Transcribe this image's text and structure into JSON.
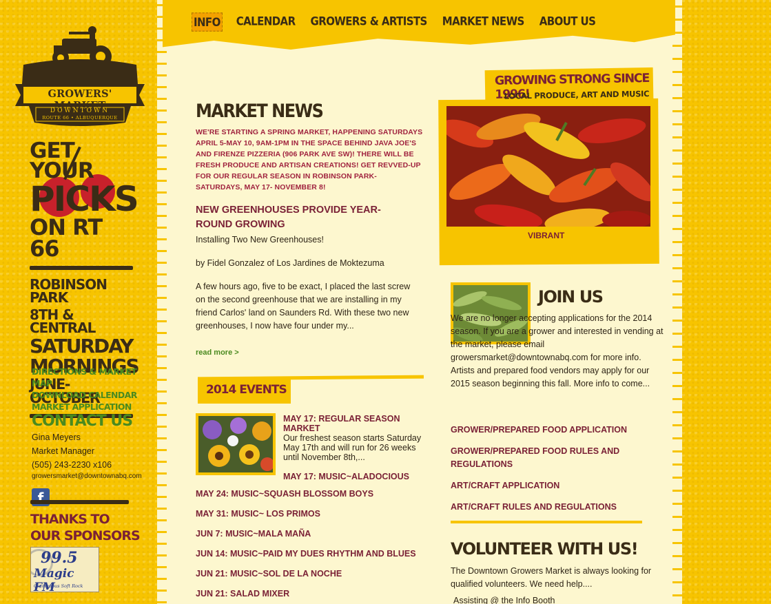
{
  "nav": {
    "items": [
      "INFO",
      "CALENDAR",
      "GROWERS & ARTISTS",
      "MARKET NEWS",
      "ABOUT US"
    ],
    "active": "INFO"
  },
  "logo": {
    "name": "GROWERS' MARKET",
    "sub1": "DOWNTOWN",
    "sub2": "ROUTE 66 • ALBUQUERQUE"
  },
  "promo": {
    "line1": "GET YOUR",
    "line2": "PICKS",
    "line3": "ON RT 66",
    "loc1": "ROBINSON PARK",
    "loc2": "8TH & CENTRAL",
    "day1": "SATURDAY",
    "day2": "MORNINGS",
    "season": "JUNE-OCTOBER"
  },
  "sidebar_links": [
    "DIRECTIONS & MARKET MAP",
    "DOWNLOAD CALENDAR",
    "MARKET APPLICATION"
  ],
  "contact": {
    "title": "CONTACT US",
    "name": "Gina Meyers",
    "role": "Market Manager",
    "phone": "(505) 243-2230 x106",
    "email": "growersmarket@downtownabq.com"
  },
  "sponsors": {
    "title1": "THANKS TO",
    "title2": "OUR SPONSORS",
    "radio_num": "99.5",
    "radio_name": "Magic FM",
    "radio_tag": "Continuous Soft Rock"
  },
  "news": {
    "heading": "MARKET NEWS",
    "alert": "WE'RE STARTING A SPRING MARKET, HAPPENING SATURDAYS APRIL 5-MAY 10, 9AM-1PM IN THE SPACE BEHIND JAVA JOE'S AND FIRENZE PIZZERIA (906 PARK AVE SW)! THERE WILL BE FRESH PRODUCE AND ARTISAN CREATIONS! GET REVVED-UP FOR OUR REGULAR SEASON IN ROBINSON PARK- SATURDAYS, MAY 17- NOVEMBER 8!",
    "post_title": "NEW GREENHOUSES PROVIDE YEAR-ROUND GROWING",
    "post_sub": "Installing Two New Greenhouses!",
    "post_byline": "by Fidel Gonzalez of Los Jardines de Moktezuma",
    "post_excerpt": "A few hours ago, five to be exact, I placed the last screw on the second greenhouse that we are installing in my friend Carlos' land on Saunders Rd. With these two new greenhouses, I now have four under my...",
    "read_more": "read more >"
  },
  "events": {
    "heading": "2014 EVENTS",
    "featured_title": "MAY 17: REGULAR SEASON MARKET",
    "featured_desc": "Our freshest season starts Saturday May 17th and will run for 26 weeks until November 8th,...",
    "featured_next": "MAY 17: MUSIC~ALADOCIOUS",
    "list": [
      "MAY 24: MUSIC~SQUASH BLOSSOM BOYS",
      "MAY 31: MUSIC~ LOS PRIMOS",
      "JUN 7: MUSIC~MALA MAÑA",
      "JUN 14: MUSIC~PAID MY DUES RHYTHM AND BLUES",
      "JUN 21: MUSIC~SOL DE LA NOCHE",
      "JUN 21: SALAD MIXER"
    ]
  },
  "feature": {
    "banner": "GROWING STRONG SINCE 1996!",
    "sub": "LOCAL PRODUCE, ART AND MUSIC",
    "caption": "VIBRANT"
  },
  "join": {
    "heading": "JOIN US",
    "text": "We are no longer accepting applications for the 2014 season. If you are a grower and interested in vending at the market, please email growersmarket@downtownabq.com for more info. Artists and prepared food vendors may apply for our 2015 season beginning this fall. More info to come...",
    "links": [
      "GROWER/PREPARED FOOD APPLICATION",
      "GROWER/PREPARED FOOD RULES AND REGULATIONS",
      "ART/CRAFT APPLICATION",
      "ART/CRAFT RULES AND REGULATIONS"
    ]
  },
  "volunteer": {
    "heading": "VOLUNTEER WITH US!",
    "text": "The Downtown Growers Market is always looking for qualified volunteers. We need help....",
    "item": "Assisting @ the Info Booth"
  },
  "colors": {
    "yellow": "#f7c400",
    "cream": "#fdf7cf",
    "maroon": "#7a2136",
    "brown": "#3a2c16",
    "green": "#4a8a1f"
  }
}
